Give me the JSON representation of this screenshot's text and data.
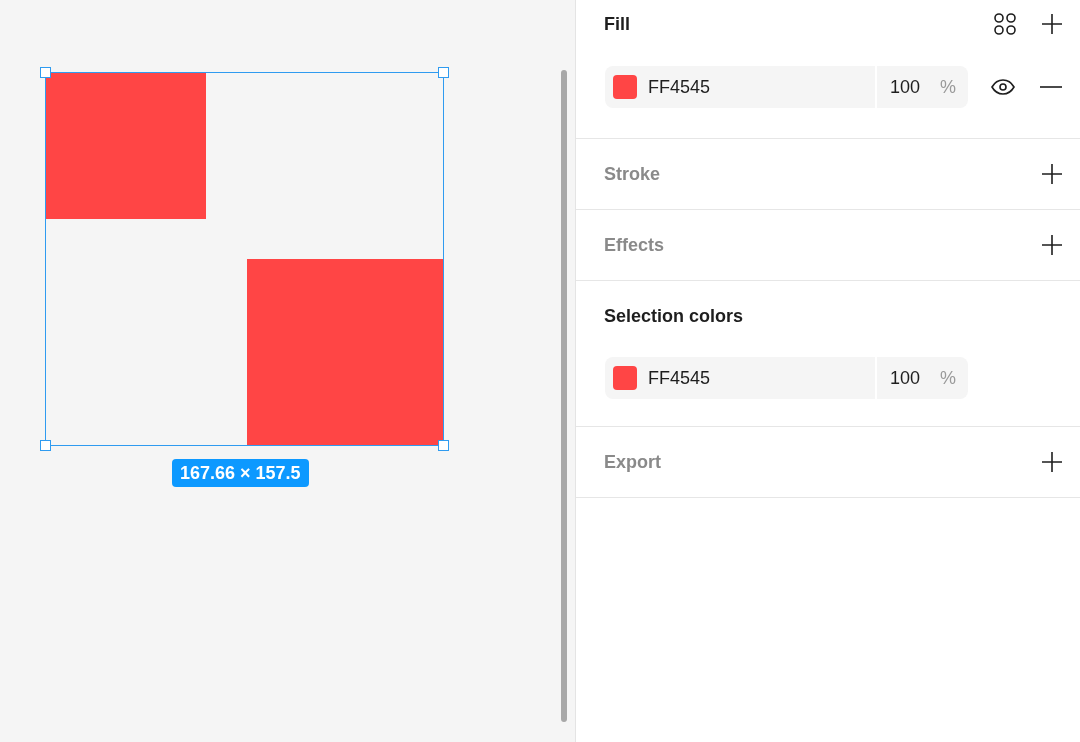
{
  "canvas": {
    "shapes": [
      {
        "kind": "rectangle"
      },
      {
        "kind": "rectangle"
      }
    ],
    "selection": {
      "size_label": "167.66 × 157.5"
    }
  },
  "properties_panel": {
    "sections": [
      {
        "kind": "fill",
        "title": "Fill",
        "rows": [
          {
            "color": "#ff4545",
            "hex": "FF4545",
            "opacity": "100",
            "unit": "%",
            "visible": true
          }
        ]
      },
      {
        "kind": "empty",
        "title": "Stroke"
      },
      {
        "kind": "empty",
        "title": "Effects"
      },
      {
        "kind": "colors",
        "title": "Selection colors",
        "rows": [
          {
            "color": "#ff4545",
            "hex": "FF4545",
            "opacity": "100",
            "unit": "%"
          }
        ]
      },
      {
        "kind": "empty",
        "title": "Export"
      }
    ]
  }
}
